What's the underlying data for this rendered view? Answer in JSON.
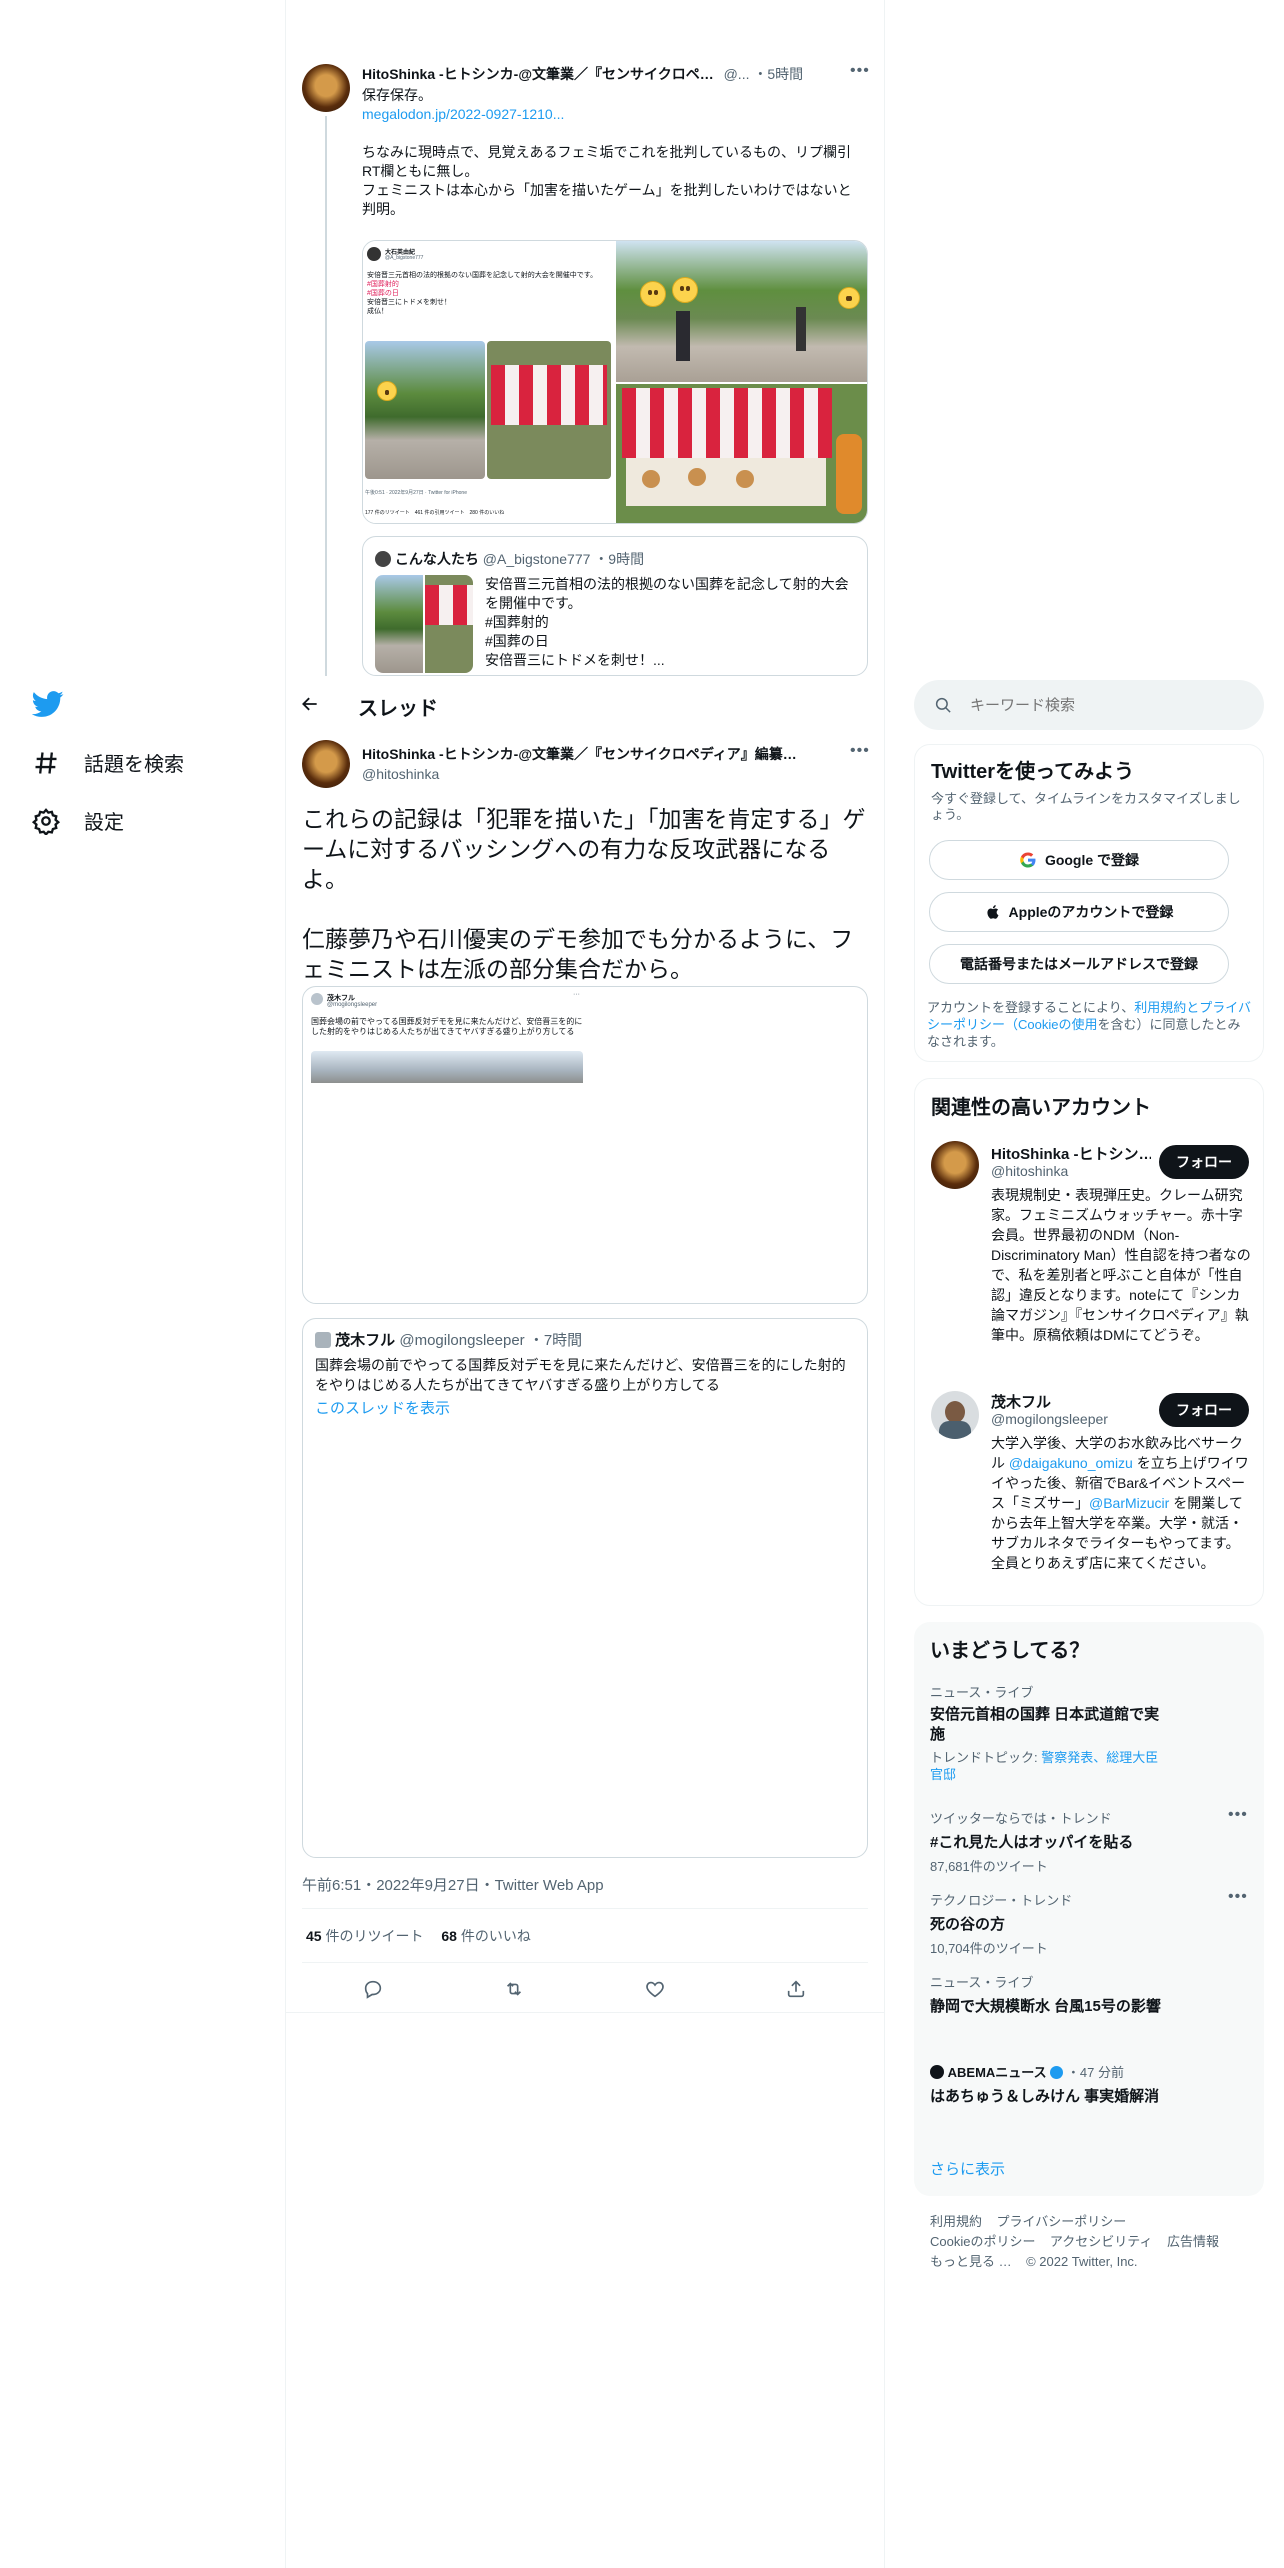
{
  "nav": {
    "explore_label": "話題を検索",
    "settings_label": "設定"
  },
  "header": {
    "back_icon": "arrow-left-icon",
    "title": "スレッド"
  },
  "search": {
    "placeholder": "キーワード検索"
  },
  "prev_tweet": {
    "name": "HitoShinka -ヒトシンカ-@文筆業／『センサイクロペ…",
    "handle": "@...",
    "time": "・5時間",
    "line1": "保存保存。",
    "link": "megalodon.jp/2022-0927-1210...",
    "para1": "ちなみに現時点で、見覚えあるフェミ垢でこれを批判しているもの、リプ欄引RT欄ともに無し。",
    "para2": "フェミニストは本心から「加害を描いたゲーム」を批判したいわけではないと判明。",
    "photo_tweet": {
      "name": "大石英由紀",
      "handle": "@A_bigstone777",
      "text1": "安倍晋三元首相の法的根拠のない国葬を記念して射的大会を開催中です。",
      "tag1": "#国葬射的",
      "tag2": "#国葬の日",
      "text2": "安倍晋三にトドメを刺せ！",
      "text3": "成仏！",
      "meta": "午後0:51 · 2022年9月27日 · Twitter for iPhone",
      "stats": "177 件のリツイート　461 件の引用ツイート　280 件のいいね"
    },
    "quote": {
      "name": "こんな人たち",
      "handle": "@A_bigstone777",
      "time": "・9時間",
      "text1": "安倍晋三元首相の法的根拠のない国葬を記念して射的大会を開催中です。",
      "tag1": "#国葬射的",
      "tag2": "#国葬の日",
      "text3": "安倍晋三にトドメを刺せ！..."
    }
  },
  "main_tweet": {
    "name": "HitoShinka -ヒトシンカ-@文筆業／『センサイクロペディア』編纂…",
    "handle": "@hitoshinka",
    "para1": "これらの記録は「犯罪を描いた」「加害を肯定する」ゲームに対するバッシングへの有力な反攻武器になるよ。",
    "para2": "仁藤夢乃や石川優実のデモ参加でも分かるように、フェミニストは左派の部分集合だから。",
    "card": {
      "name": "茂木フル",
      "handle": "@mogilongsleeper",
      "text": "国葬会場の前でやってる国葬反対デモを見に来たんだけど、安倍晋三を的にした射的をやりはじめる人たちが出てきてヤバすぎる盛り上がり方してる"
    },
    "quote": {
      "name": "茂木フル",
      "handle": "@mogilongsleeper",
      "time": "・7時間",
      "text": "国葬会場の前でやってる国葬反対デモを見に来たんだけど、安倍晋三を的にした射的をやりはじめる人たちが出てきてヤバすぎる盛り上がり方してる",
      "show_thread": "このスレッドを表示"
    },
    "meta": "午前6:51・2022年9月27日・Twitter Web App",
    "retweets_count": "45",
    "retweets_label": "件のリツイート",
    "likes_count": "68",
    "likes_label": "件のいいね"
  },
  "signup": {
    "title": "Twitterを使ってみよう",
    "subtitle": "今すぐ登録して、タイムラインをカスタマイズしましょう。",
    "google_label": "Google で登録",
    "apple_label": "Appleのアカウントで登録",
    "phone_label": "電話番号またはメールアドレスで登録",
    "terms_pre": "アカウントを登録することにより、",
    "terms_link1": "利用規約とプライバシーポリシー（Cookieの使用",
    "terms_post": "を含む）に同意したとみなされます。"
  },
  "related": {
    "title": "関連性の高いアカウント",
    "accounts": [
      {
        "name": "HitoShinka -ヒトシン…",
        "handle": "@hitoshinka",
        "follow": "フォロー",
        "bio": "表現規制史・表現弾圧史。クレーム研究家。フェミニズムウォッチャー。赤十字会員。世界最初のNDM（Non-Discriminatory Man）性自認を持つ者なので、私を差別者と呼ぶこと自体が「性自認」違反となります。noteにて『シンカ論マガジン』『センサイクロペディア』執筆中。原稿依頼はDMにてどうぞ。"
      },
      {
        "name": "茂木フル",
        "handle": "@mogilongsleeper",
        "follow": "フォロー",
        "bio_1": "大学入学後、大学のお水飲み比べサークル ",
        "bio_link1": "@daigakuno_omizu",
        "bio_2": " を立ち上げワイワイやった後、新宿でBar&イベントスペース「ミズサー」",
        "bio_link2": "@BarMizucir",
        "bio_3": " を開業してから去年上智大学を卒業。大学・就活・サブカルネタでライターもやってます。全員とりあえず店に来てください。"
      }
    ]
  },
  "trends": {
    "title": "いまどうしてる？",
    "items": [
      {
        "category": "ニュース・ライブ",
        "title": "安倍元首相の国葬 日本武道館で実施",
        "sub_pre": "トレンドトピック: ",
        "sub_link": "警察発表、総理大臣官邸"
      },
      {
        "category": "ツイッターならでは・トレンド",
        "title": "#これ見た人はオッパイを貼る",
        "count": "87,681件のツイート"
      },
      {
        "category": "テクノロジー・トレンド",
        "title": "死の谷の方",
        "count": "10,704件のツイート"
      },
      {
        "category": "ニュース・ライブ",
        "title": "静岡で大規模断水 台風15号の影響"
      },
      {
        "source": "ABEMAニュース",
        "time": "・47 分前",
        "title": "はあちゅう＆しみけん 事実婚解消"
      }
    ],
    "show_more": "さらに表示"
  },
  "footer": {
    "terms": "利用規約",
    "privacy": "プライバシーポリシー",
    "cookie": "Cookieのポリシー",
    "accessibility": "アクセシビリティ",
    "ads": "広告情報",
    "more": "もっと見る …",
    "copyright": "© 2022 Twitter, Inc."
  },
  "colors": {
    "accent": "#1d9bf0",
    "text": "#0f1419",
    "muted": "#536471",
    "border": "#eff3f4",
    "panel": "#f7f9f9"
  }
}
